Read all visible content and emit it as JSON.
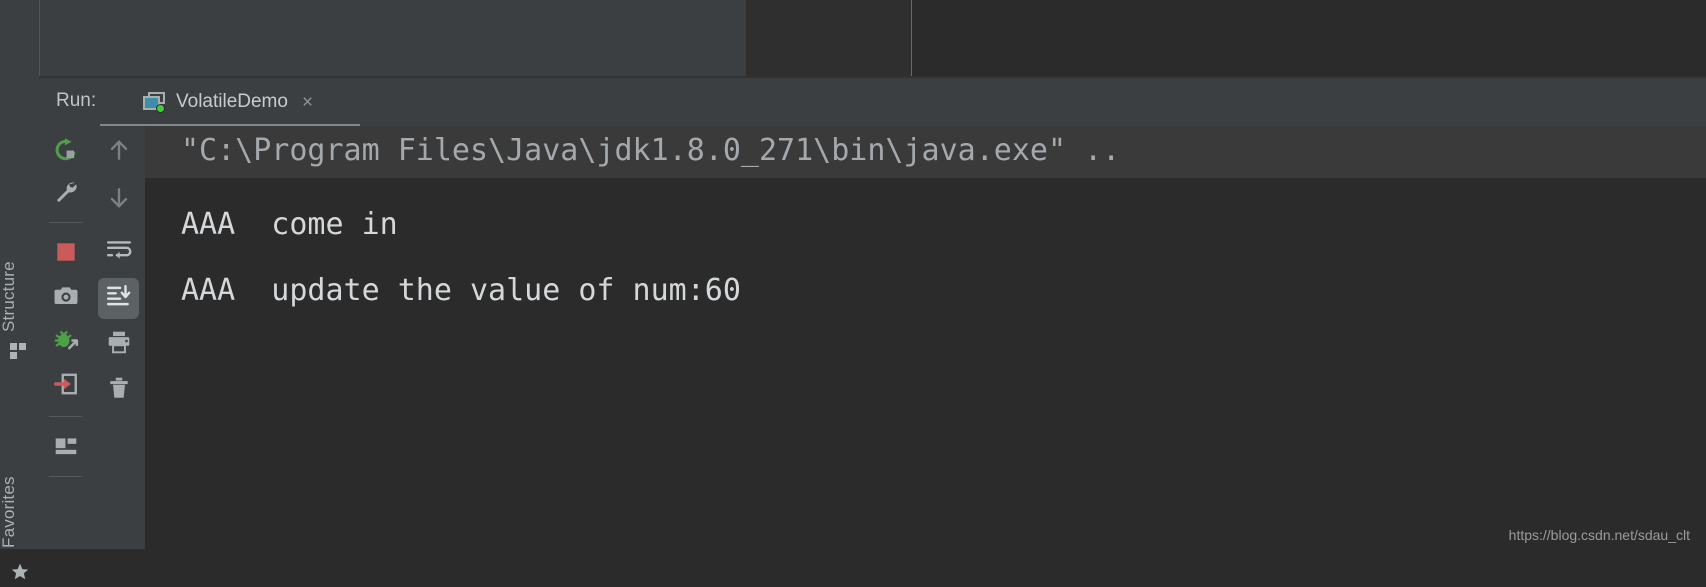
{
  "window": {
    "background_color": "#2b2b2b",
    "panel_color": "#3c3f41"
  },
  "left_tool_strip": {
    "items": [
      {
        "label": "Structure",
        "icon": "structure-grid-icon"
      },
      {
        "label": "Favorites",
        "icon": "star-icon"
      }
    ]
  },
  "run_panel": {
    "title": "Run:",
    "tab": {
      "label": "VolatileDemo",
      "close_label": "×",
      "icon": "run-configuration-icon",
      "status_color": "#3fcc3f"
    },
    "toolbar_primary": [
      {
        "name": "rerun-button",
        "icon": "rerun-green-arrow-icon"
      },
      {
        "name": "edit-configuration-button",
        "icon": "wrench-icon"
      },
      {
        "name": "stop-button",
        "icon": "stop-red-square-icon",
        "color": "#cc5555"
      },
      {
        "name": "snapshot-button",
        "icon": "camera-icon"
      },
      {
        "name": "attach-profiler-button",
        "icon": "green-bug-arrow-icon",
        "color": "#5aa84f"
      },
      {
        "name": "export-button",
        "icon": "red-arrow-into-box-icon",
        "color": "#cc5555"
      },
      {
        "name": "layout-button",
        "icon": "panel-layout-icon"
      }
    ],
    "toolbar_secondary": [
      {
        "name": "up-button",
        "icon": "arrow-up-icon"
      },
      {
        "name": "down-button",
        "icon": "arrow-down-icon"
      },
      {
        "name": "soft-wrap-button",
        "icon": "soft-wrap-icon"
      },
      {
        "name": "scroll-to-end-button",
        "icon": "scroll-to-end-icon",
        "selected": true
      },
      {
        "name": "print-button",
        "icon": "printer-icon"
      },
      {
        "name": "clear-all-button",
        "icon": "trash-icon"
      }
    ]
  },
  "console": {
    "lines": [
      {
        "text": "\"C:\\Program Files\\Java\\jdk1.8.0_271\\bin\\java.exe\" ..",
        "style": "command",
        "color": "#a4a9ad",
        "highlight": true
      },
      {
        "text": "AAA  come in",
        "style": "output",
        "color": "#d5d8da",
        "highlight": false
      },
      {
        "text": "AAA  update the value of num:60",
        "style": "output",
        "color": "#d5d8da",
        "highlight": false
      }
    ]
  },
  "watermark": {
    "text": "https://blog.csdn.net/sdau_clt"
  }
}
